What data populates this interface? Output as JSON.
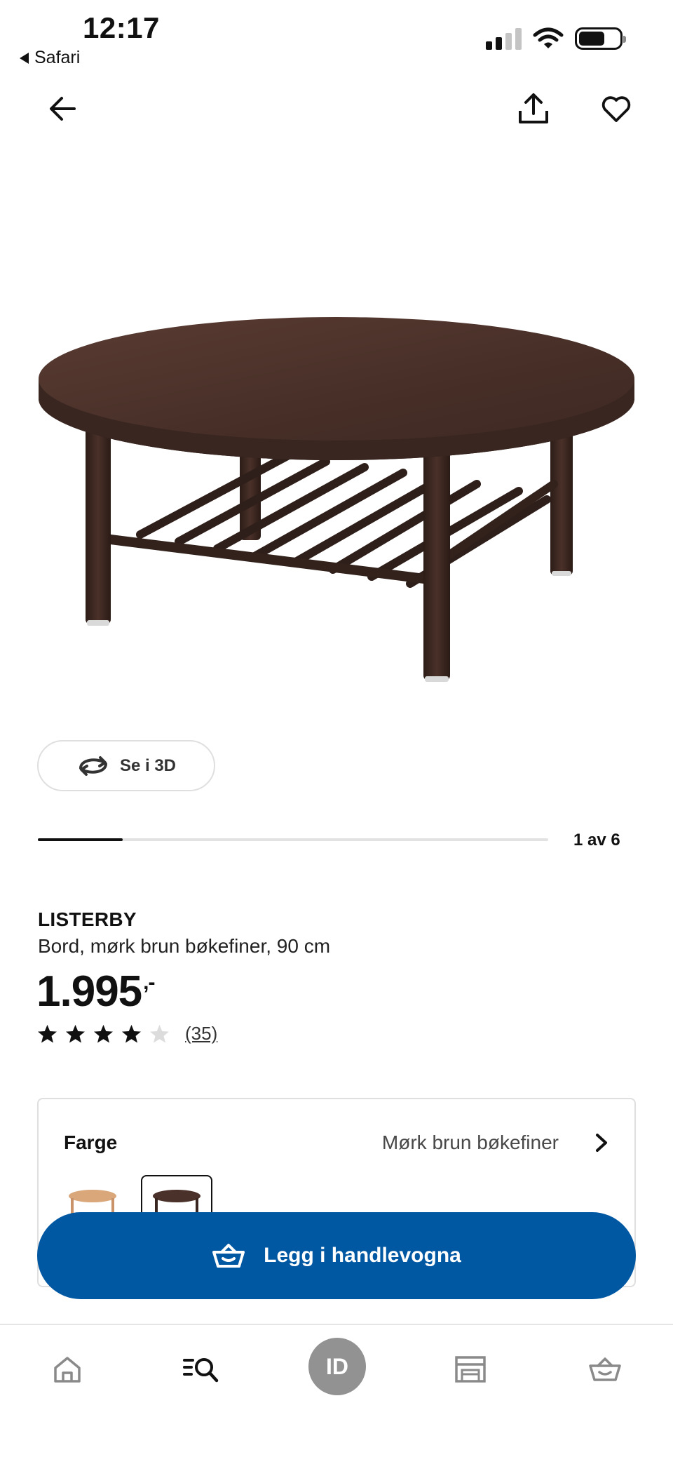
{
  "status_bar": {
    "time": "12:17",
    "back_app": "Safari"
  },
  "nav": {
    "back_icon": "arrow-left-icon",
    "share_icon": "share-icon",
    "favorite_icon": "heart-icon"
  },
  "product": {
    "image_alt": "LISTERBY round coffee table in dark brown beech veneer with slatted shelf",
    "view_3d_label": "Se i 3D",
    "carousel": {
      "current": 1,
      "total": 6,
      "counter_text": "1 av 6"
    },
    "brand": "LISTERBY",
    "description": "Bord, mørk brun bøkefiner, 90 cm",
    "price": "1.995",
    "price_suffix": ",-",
    "rating": {
      "stars": 4,
      "max": 5,
      "review_count_text": "(35)"
    }
  },
  "color": {
    "label": "Farge",
    "value": "Mørk brun bøkefiner",
    "swatches": [
      {
        "name": "light-beech",
        "selected": false
      },
      {
        "name": "dark-brown-beech",
        "selected": true
      }
    ]
  },
  "cart_button": {
    "label": "Legg i handlevogna",
    "icon": "basket-icon",
    "color": "#0058a3"
  },
  "tab_bar": {
    "items": [
      {
        "name": "home",
        "icon": "home-icon"
      },
      {
        "name": "search",
        "icon": "search-list-icon"
      },
      {
        "name": "id",
        "label": "ID"
      },
      {
        "name": "store",
        "icon": "store-icon"
      },
      {
        "name": "cart",
        "icon": "basket-icon"
      }
    ]
  },
  "colors": {
    "accent_blue": "#0058a3",
    "table_brown": "#4a3129"
  }
}
